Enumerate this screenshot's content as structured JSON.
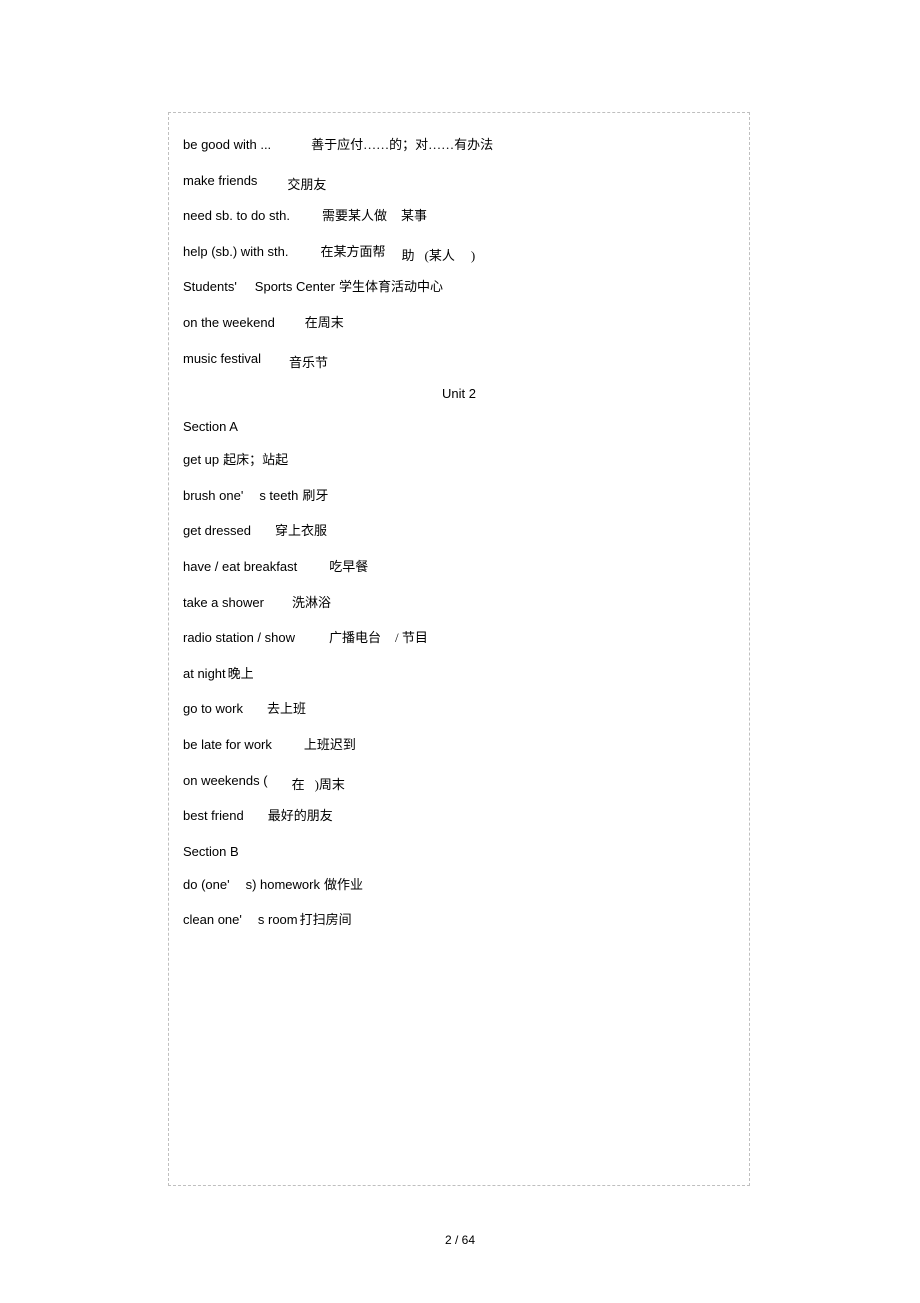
{
  "top_entries": [
    {
      "parts": [
        {
          "text": "be good with ...",
          "cls": "en",
          "gap": 40
        },
        {
          "text": "善于应付……的；对……有办法",
          "cls": "zh"
        }
      ]
    },
    {
      "parts": [
        {
          "text": "make friends",
          "cls": "en",
          "gap": 30
        },
        {
          "text": "交朋友",
          "cls": "zh vbump-down"
        }
      ]
    },
    {
      "parts": [
        {
          "text": "need sb. to do sth.",
          "cls": "en",
          "gap": 32
        },
        {
          "text": "需要某人做",
          "cls": "zh",
          "gap": 14
        },
        {
          "text": "某事",
          "cls": "zh"
        }
      ]
    },
    {
      "parts": [
        {
          "text": "help (sb.) with sth.",
          "cls": "en",
          "gap": 32
        },
        {
          "text": "在某方面帮",
          "cls": "zh",
          "gap": 16
        },
        {
          "text": "助",
          "cls": "zh vbump-down",
          "gap": 10
        },
        {
          "text": "(某人",
          "cls": "zh vbump-down",
          "gap": 16
        },
        {
          "text": ")",
          "cls": "zh vbump-down"
        }
      ]
    },
    {
      "parts": [
        {
          "text": "Students'",
          "cls": "en",
          "gap": 18
        },
        {
          "text": "Sports Center",
          "cls": "en",
          "gap": 4
        },
        {
          "text": "学生体育活动中心",
          "cls": "zh"
        }
      ]
    },
    {
      "parts": [
        {
          "text": "on the weekend",
          "cls": "en",
          "gap": 30
        },
        {
          "text": "在周末",
          "cls": "zh"
        }
      ]
    },
    {
      "parts": [
        {
          "text": "music festival",
          "cls": "en",
          "gap": 28
        },
        {
          "text": "音乐节",
          "cls": "zh vbump-down"
        }
      ]
    }
  ],
  "unit_title": "Unit 2",
  "section_a_label": "Section A",
  "section_a_entries": [
    {
      "parts": [
        {
          "text": "get up",
          "cls": "en",
          "gap": 4
        },
        {
          "text": "起床；站起",
          "cls": "zh"
        }
      ]
    },
    {
      "parts": [
        {
          "text": "brush one'",
          "cls": "en",
          "gap": 16
        },
        {
          "text": "s teeth",
          "cls": "en",
          "gap": 4
        },
        {
          "text": "刷牙",
          "cls": "zh"
        }
      ]
    },
    {
      "parts": [
        {
          "text": "get dressed",
          "cls": "en",
          "gap": 24
        },
        {
          "text": "穿上衣服",
          "cls": "zh"
        }
      ]
    },
    {
      "parts": [
        {
          "text": "have / eat breakfast",
          "cls": "en",
          "gap": 32
        },
        {
          "text": "吃早餐",
          "cls": "zh"
        }
      ]
    },
    {
      "parts": [
        {
          "text": "take a shower",
          "cls": "en",
          "gap": 28
        },
        {
          "text": "洗淋浴",
          "cls": "zh"
        }
      ]
    },
    {
      "parts": [
        {
          "text": "radio station / show",
          "cls": "en",
          "gap": 34
        },
        {
          "text": "广播电台",
          "cls": "zh",
          "gap": 14
        },
        {
          "text": "/ 节目",
          "cls": "zh"
        }
      ]
    },
    {
      "parts": [
        {
          "text": "at night",
          "cls": "en",
          "gap": 2
        },
        {
          "text": "晚上",
          "cls": "zh"
        }
      ]
    },
    {
      "parts": [
        {
          "text": "go to work",
          "cls": "en",
          "gap": 24
        },
        {
          "text": "去上班",
          "cls": "zh"
        }
      ]
    },
    {
      "parts": [
        {
          "text": "be late for work",
          "cls": "en",
          "gap": 32
        },
        {
          "text": "上班迟到",
          "cls": "zh"
        }
      ]
    },
    {
      "parts": [
        {
          "text": "on weekends (",
          "cls": "en",
          "gap": 24
        },
        {
          "text": "在",
          "cls": "zh vbump-down",
          "gap": 10
        },
        {
          "text": ")周末",
          "cls": "zh vbump-down"
        }
      ]
    },
    {
      "parts": [
        {
          "text": "best friend",
          "cls": "en",
          "gap": 24
        },
        {
          "text": "最好的朋友",
          "cls": "zh"
        }
      ]
    }
  ],
  "section_b_label": "Section B",
  "section_b_entries": [
    {
      "parts": [
        {
          "text": "do (one'",
          "cls": "en",
          "gap": 16
        },
        {
          "text": "s) homework",
          "cls": "en",
          "gap": 4
        },
        {
          "text": "做作业",
          "cls": "zh"
        }
      ]
    },
    {
      "parts": [
        {
          "text": "clean one'",
          "cls": "en",
          "gap": 16
        },
        {
          "text": "s room",
          "cls": "en",
          "gap": 2
        },
        {
          "text": "打扫房间",
          "cls": "zh"
        }
      ]
    }
  ],
  "page_number": "2",
  "page_total": "64",
  "page_sep": "/"
}
